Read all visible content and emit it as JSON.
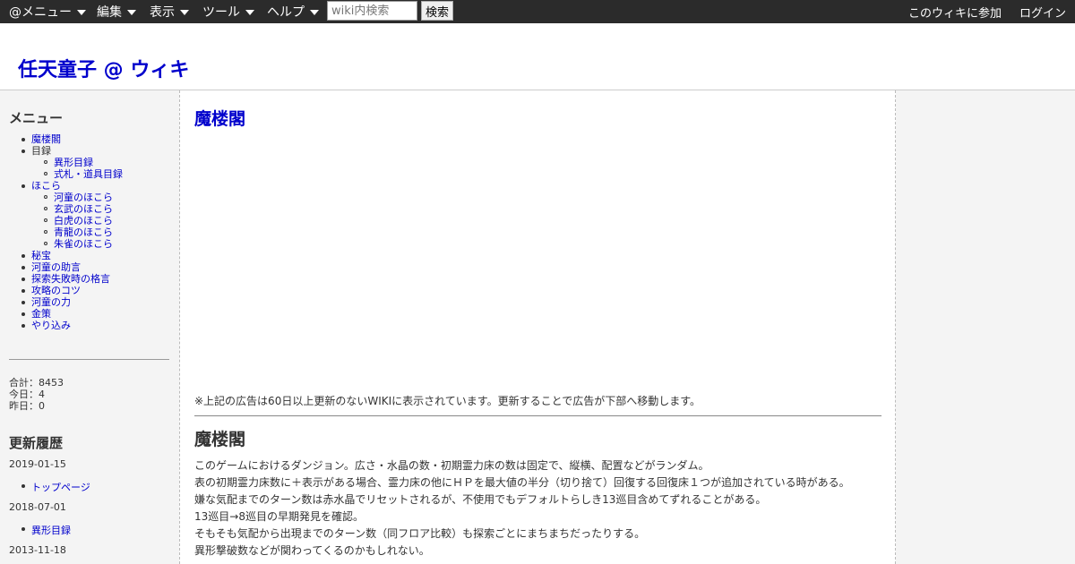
{
  "topbar": {
    "menus": [
      {
        "label": "@メニュー"
      },
      {
        "label": "編集"
      },
      {
        "label": "表示"
      },
      {
        "label": "ツール"
      },
      {
        "label": "ヘルプ"
      }
    ],
    "search_placeholder": "wiki内検索",
    "search_button": "検索",
    "join_link": "このウィキに参加",
    "login_link": "ログイン",
    "bar_color": "#2b2b2b"
  },
  "site": {
    "title": "任天童子 @ ウィキ",
    "link_color": "#0000cc"
  },
  "sidebar": {
    "menu_heading": "メニュー",
    "menu": [
      {
        "label": "魔楼閣"
      },
      {
        "label": "目録",
        "children": [
          "異形目録",
          "式札・道具目録"
        ]
      },
      {
        "label": "ほこら",
        "children": [
          "河童のほこら",
          "玄武のほこら",
          "白虎のほこら",
          "青龍のほこら",
          "朱雀のほこら"
        ]
      },
      {
        "label": "秘宝"
      },
      {
        "label": "河童の助言"
      },
      {
        "label": "探索失敗時の格言"
      },
      {
        "label": "攻略のコツ"
      },
      {
        "label": "河童の力"
      },
      {
        "label": "金策"
      },
      {
        "label": "やり込み"
      }
    ],
    "counter": {
      "total": "合計：8453",
      "today": "今日：4",
      "yesterday": "昨日：0"
    },
    "history_heading": "更新履歴",
    "history": [
      {
        "date": "2019-01-15",
        "page": "トップページ"
      },
      {
        "date": "2018-07-01",
        "page": "異形目録"
      },
      {
        "date": "2013-11-18",
        "page": ""
      }
    ]
  },
  "main": {
    "page_title": "魔楼閣",
    "ad_notice": "※上記の広告は60日以上更新のないWIKIに表示されています。更新することで広告が下部へ移動します。",
    "section_heading": "魔楼閣",
    "paragraphs": [
      "このゲームにおけるダンジョン。広さ・水晶の数・初期霊力床の数は固定で、縦横、配置などがランダム。",
      "表の初期霊力床数に＋表示がある場合、霊力床の他にＨＰを最大値の半分（切り捨て）回復する回復床１つが追加されている時がある。",
      "嫌な気配までのターン数は赤水晶でリセットされるが、不使用でもデフォルトらしき13巡目含めてずれることがある。",
      "13巡目→8巡目の早期発見を確認。",
      "そもそも気配から出現までのターン数（同フロア比較）も探索ごとにまちまちだったりする。",
      "異形撃破数などが関わってくるのかもしれない。"
    ]
  }
}
